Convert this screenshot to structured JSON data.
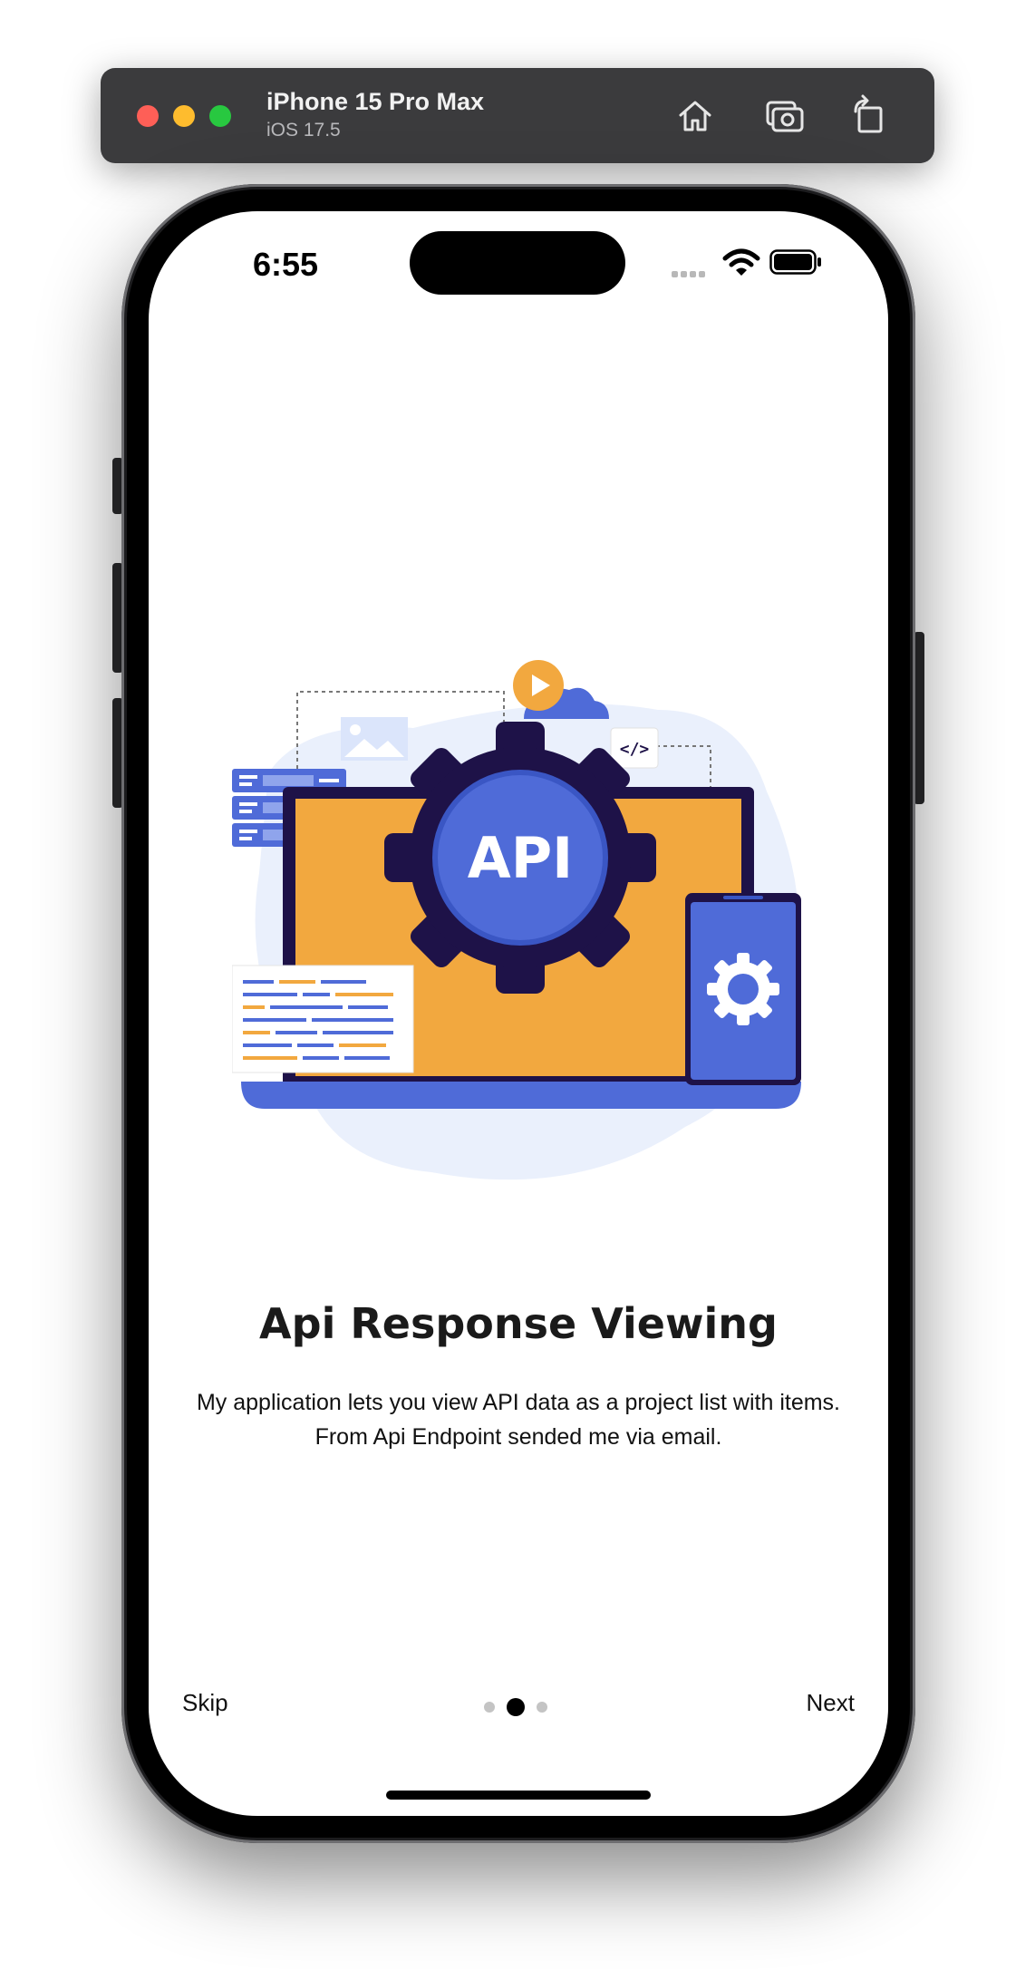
{
  "simulator": {
    "device_name": "iPhone 15 Pro Max",
    "os_version": "iOS 17.5",
    "home_icon": "home-icon",
    "screenshot_icon": "camera-icon",
    "rotate_icon": "rotate-icon"
  },
  "status_bar": {
    "time": "6:55",
    "wifi_icon": "wifi-icon",
    "battery_icon": "battery-icon"
  },
  "onboarding": {
    "illustration_label": "API",
    "title": "Api Response Viewing",
    "description_lines": [
      "My application lets you view API data as a project list with items.",
      "From Api Endpoint sended me via email."
    ],
    "skip_label": "Skip",
    "next_label": "Next",
    "pages_total": 3,
    "current_page": 2
  },
  "colors": {
    "accent_blue": "#4f6bd8",
    "accent_orange": "#f2a83f",
    "gear_dark": "#1e1248"
  }
}
